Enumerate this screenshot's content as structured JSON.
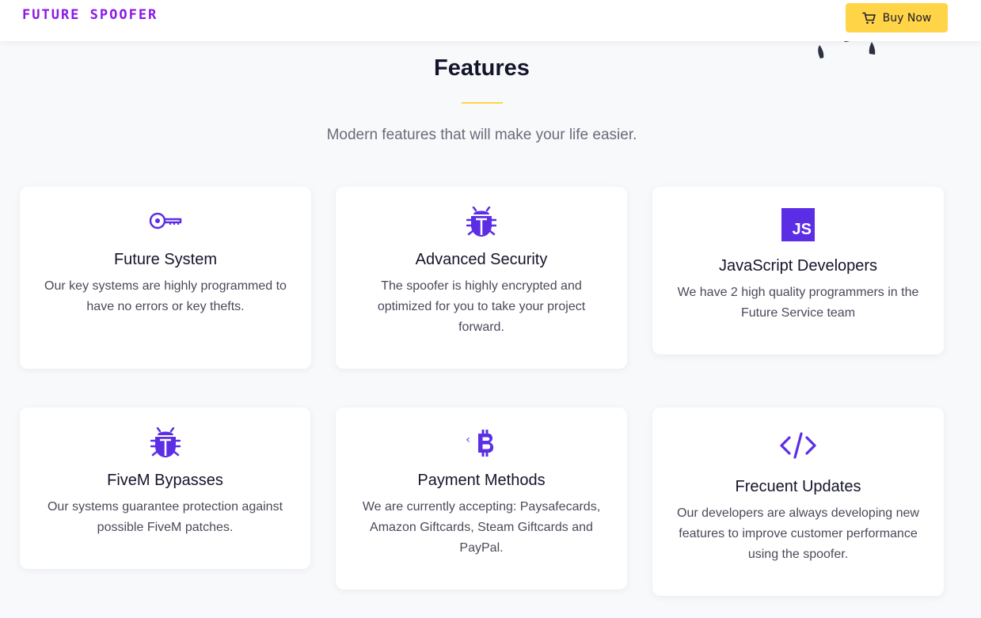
{
  "header": {
    "brand": "FUTURE SPOOFER",
    "buy_label": "Buy Now",
    "buy_icon": "cart-icon"
  },
  "section": {
    "title": "Features",
    "subtitle": "Modern features that will make your life easier."
  },
  "features": [
    {
      "icon": "key-icon",
      "title": "Future System",
      "description": "Our key systems are highly programmed to have no errors or key thefts."
    },
    {
      "icon": "bug-icon",
      "title": "Advanced Security",
      "description": "The spoofer is highly encrypted and optimized for you to take your project forward."
    },
    {
      "icon": "javascript-icon",
      "icon_text": "JS",
      "title": "JavaScript Developers",
      "description": "We have 2 high quality programmers in the Future Service team"
    },
    {
      "icon": "bug-icon",
      "title": "FiveM Bypasses",
      "description": "Our systems guarantee protection against possible FiveM patches."
    },
    {
      "icon": "bitcoin-icon",
      "icon_text": "‹",
      "title": "Payment Methods",
      "description": "We are currently accepting: Paysafecards, Amazon Giftcards, Steam Giftcards and PayPal."
    },
    {
      "icon": "code-icon",
      "title": "Frecuent Updates",
      "description": "Our developers are always developing new features to improve customer performance using the spoofer."
    }
  ],
  "colors": {
    "brand": "#8a18e8",
    "accent": "#ffd447",
    "icon": "#5b2ee6"
  }
}
